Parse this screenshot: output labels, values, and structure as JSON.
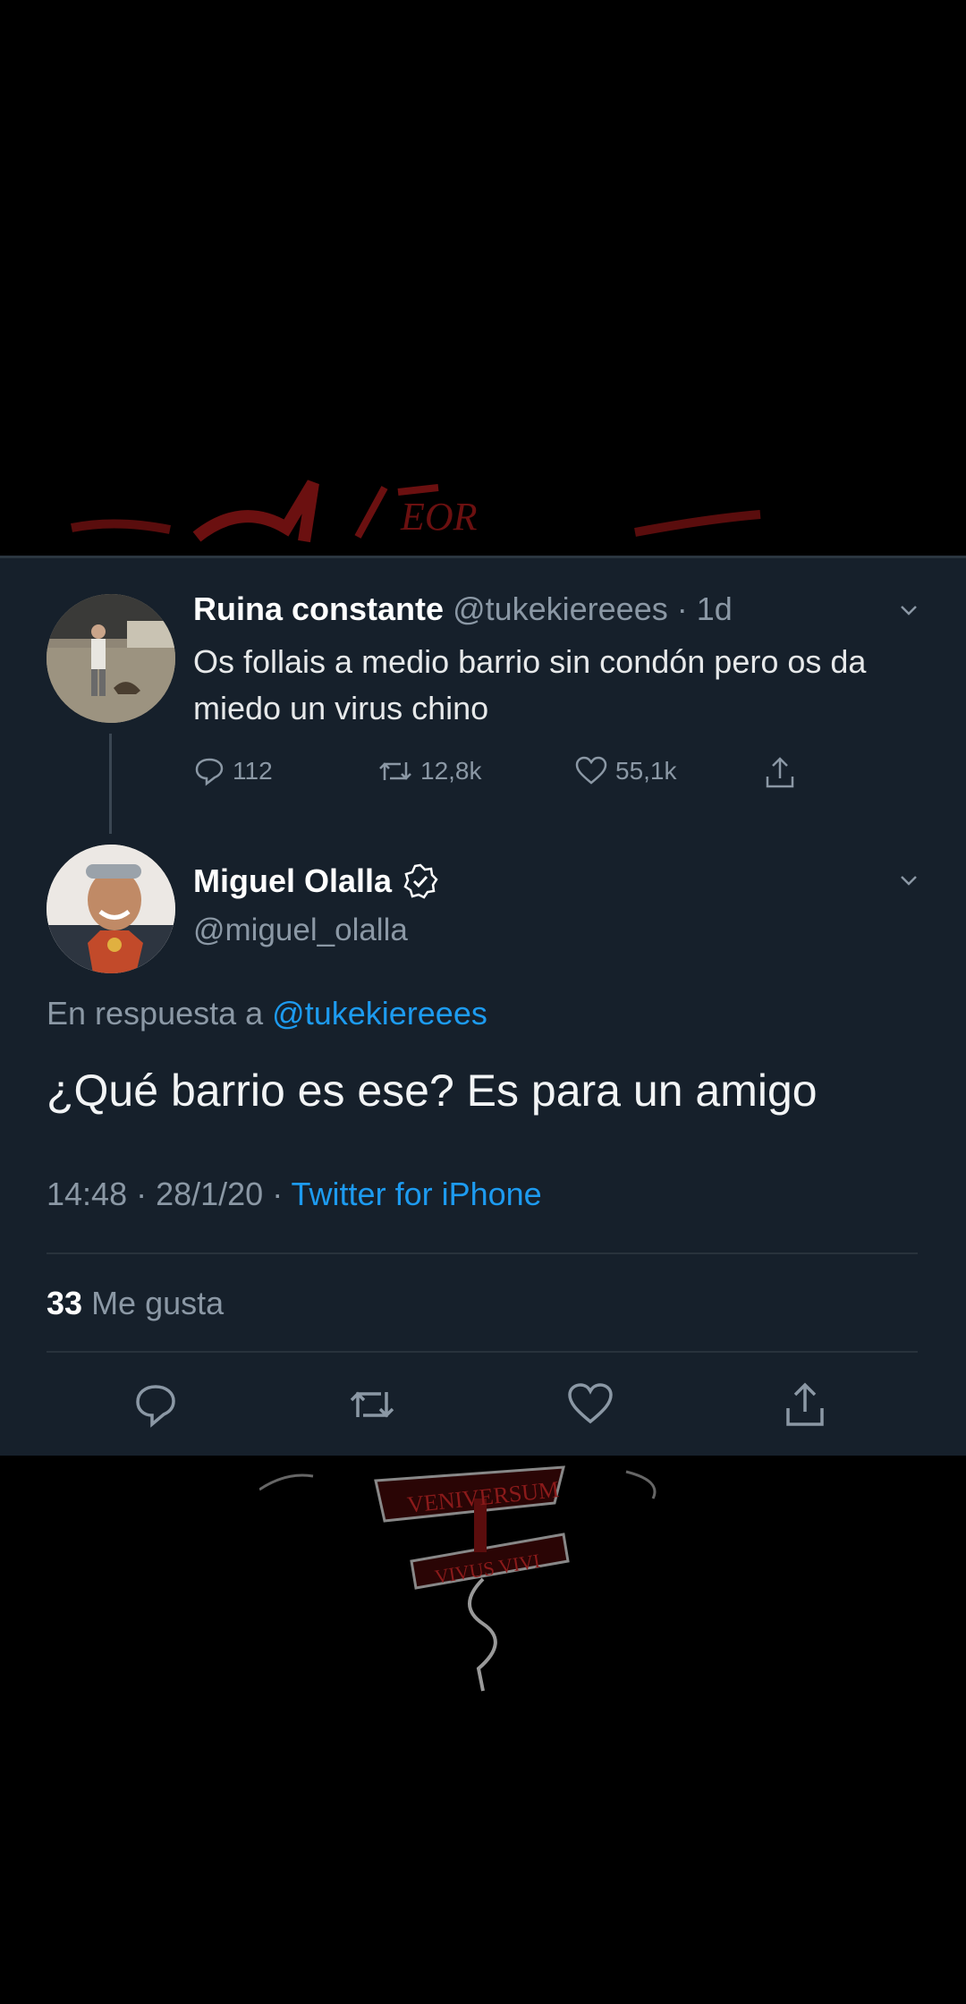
{
  "original_tweet": {
    "display_name": "Ruina constante",
    "handle": "@tukekiereees",
    "time_ago": "· 1d",
    "text": "Os follais a medio barrio sin condón pero os da miedo un virus chino",
    "replies": "112",
    "retweets": "12,8k",
    "likes": "55,1k"
  },
  "reply_tweet": {
    "display_name": "Miguel Olalla",
    "handle": "@miguel_olalla",
    "reply_prefix": "En respuesta a",
    "reply_target": "@tukekiereees",
    "text": "¿Qué barrio es ese? Es para un amigo",
    "timestamp": "14:48 · 28/1/20 ·",
    "source": "Twitter for iPhone",
    "likes_count": "33",
    "likes_label": "Me gusta"
  },
  "background_text": {
    "emblem_banner_top": "VENIVERSUM",
    "emblem_banner_bottom": "VIVUS VIVI"
  },
  "colors": {
    "card_bg": "#16202b",
    "link_blue": "#1d9bf0",
    "secondary_gray": "#8b98a5",
    "background": "#000000"
  },
  "icons": {
    "reply": "reply-icon",
    "retweet": "retweet-icon",
    "like": "heart-icon",
    "share": "share-icon",
    "verified": "verified-badge-icon",
    "more": "chevron-down-icon"
  }
}
